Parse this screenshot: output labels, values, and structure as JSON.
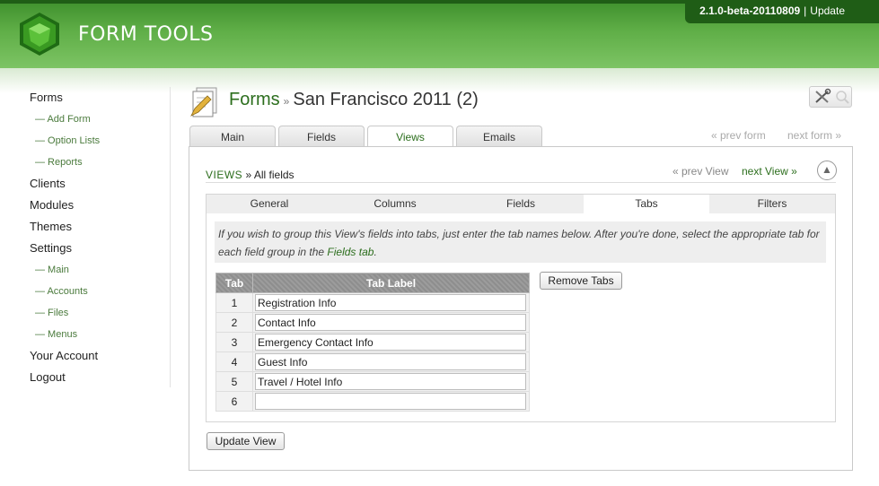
{
  "header": {
    "logo_text": "FORM TOOLS",
    "version": "2.1.0-beta-20110809",
    "separator": "|",
    "update_label": "Update",
    "brand_color": "#3e8f2c"
  },
  "nav": {
    "items": [
      {
        "label": "Forms",
        "type": "main"
      },
      {
        "label": "— Add Form",
        "type": "sub"
      },
      {
        "label": "— Option Lists",
        "type": "sub"
      },
      {
        "label": "— Reports",
        "type": "sub"
      },
      {
        "label": "Clients",
        "type": "main"
      },
      {
        "label": "Modules",
        "type": "main"
      },
      {
        "label": "Themes",
        "type": "main"
      },
      {
        "label": "Settings",
        "type": "main"
      },
      {
        "label": "— Main",
        "type": "sub"
      },
      {
        "label": "— Accounts",
        "type": "sub"
      },
      {
        "label": "— Files",
        "type": "sub"
      },
      {
        "label": "— Menus",
        "type": "sub"
      },
      {
        "label": "Your Account",
        "type": "main"
      },
      {
        "label": "Logout",
        "type": "main"
      }
    ]
  },
  "page": {
    "section": "Forms",
    "crumb_sep": "»",
    "form_name": "San Francisco 2011 (2)"
  },
  "top_tabs": [
    {
      "label": "Main"
    },
    {
      "label": "Fields"
    },
    {
      "label": "Views",
      "active": true
    },
    {
      "label": "Emails"
    }
  ],
  "form_nav": {
    "prev": "« prev form",
    "next": "next form »"
  },
  "view": {
    "crumb_section": "VIEWS",
    "crumb_sep": "»",
    "crumb_name": "All fields",
    "prev_view": "« prev View",
    "next_view": "next View »",
    "up_icon": "▲"
  },
  "inner_tabs": [
    {
      "label": "General"
    },
    {
      "label": "Columns"
    },
    {
      "label": "Fields"
    },
    {
      "label": "Tabs",
      "active": true
    },
    {
      "label": "Filters"
    }
  ],
  "info": {
    "text_before": "If you wish to group this View's fields into tabs, just enter the tab names below. After you're done, select the appropriate tab for each field group in the ",
    "link": "Fields tab",
    "text_after": "."
  },
  "tabs_table": {
    "headers": [
      "Tab",
      "Tab Label"
    ],
    "rows": [
      {
        "num": "1",
        "label": "Registration Info"
      },
      {
        "num": "2",
        "label": "Contact Info"
      },
      {
        "num": "3",
        "label": "Emergency Contact Info"
      },
      {
        "num": "4",
        "label": "Guest Info"
      },
      {
        "num": "5",
        "label": "Travel / Hotel Info"
      },
      {
        "num": "6",
        "label": ""
      }
    ]
  },
  "buttons": {
    "remove_tabs": "Remove Tabs",
    "update_view": "Update View"
  }
}
